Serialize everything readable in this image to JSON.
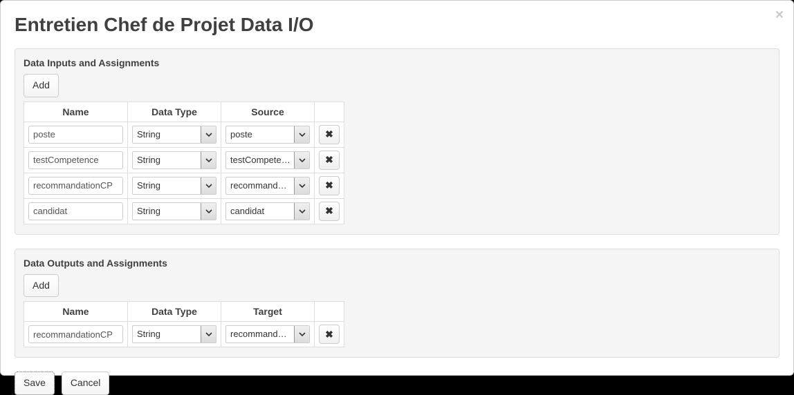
{
  "title": "Entretien Chef de Projet Data I/O",
  "close_label": "×",
  "inputs_panel": {
    "title": "Data Inputs and Assignments",
    "add_label": "Add",
    "columns": {
      "name": "Name",
      "type": "Data Type",
      "source": "Source"
    },
    "rows": [
      {
        "name": "poste",
        "type": "String",
        "source": "poste"
      },
      {
        "name": "testCompetence",
        "type": "String",
        "source": "testCompetence"
      },
      {
        "name": "recommandationCP",
        "type": "String",
        "source": "recommandationCP"
      },
      {
        "name": "candidat",
        "type": "String",
        "source": "candidat"
      }
    ]
  },
  "outputs_panel": {
    "title": "Data Outputs and Assignments",
    "add_label": "Add",
    "columns": {
      "name": "Name",
      "type": "Data Type",
      "target": "Target"
    },
    "rows": [
      {
        "name": "recommandationCP",
        "type": "String",
        "target": "recommandationCP"
      }
    ]
  },
  "footer": {
    "save_label": "Save",
    "cancel_label": "Cancel"
  },
  "icons": {
    "delete": "✖",
    "chevron_down": "▾"
  }
}
